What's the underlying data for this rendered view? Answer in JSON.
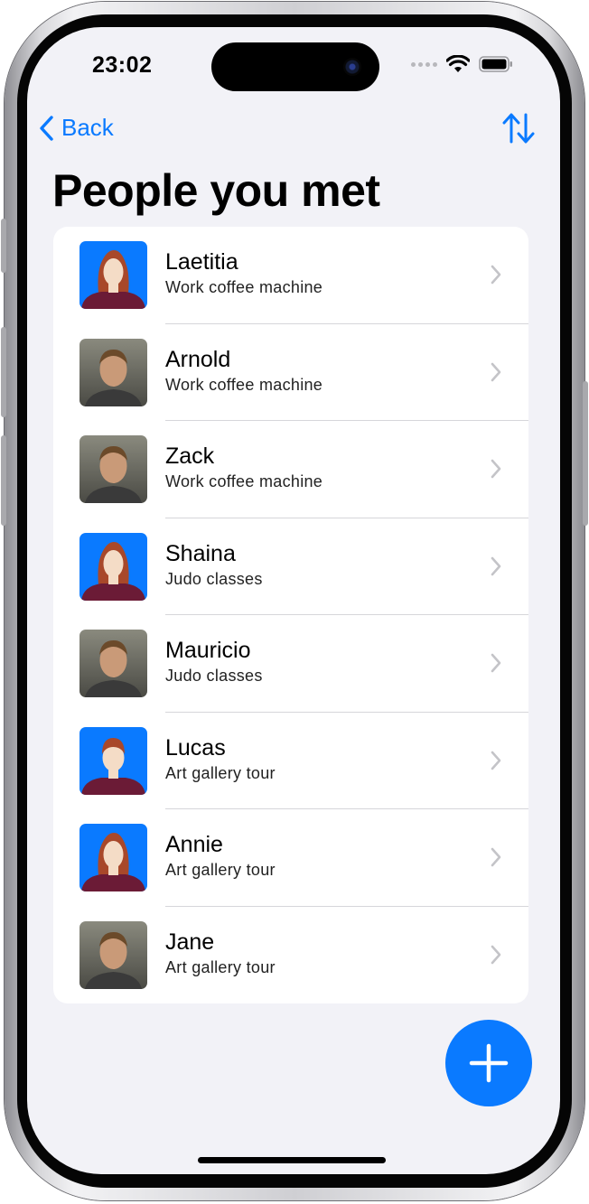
{
  "status_bar": {
    "time": "23:02"
  },
  "nav": {
    "back_label": "Back"
  },
  "page": {
    "title": "People you met"
  },
  "people": [
    {
      "name": "Laetitia",
      "place": "Work coffee machine",
      "avatar": "placeholder-woman-avatar"
    },
    {
      "name": "Arnold",
      "place": "Work coffee machine",
      "avatar": "photo-avatar"
    },
    {
      "name": "Zack",
      "place": "Work coffee machine",
      "avatar": "photo-avatar"
    },
    {
      "name": "Shaina",
      "place": "Judo classes",
      "avatar": "placeholder-woman-avatar"
    },
    {
      "name": "Mauricio",
      "place": "Judo classes",
      "avatar": "photo-avatar"
    },
    {
      "name": "Lucas",
      "place": "Art gallery tour",
      "avatar": "placeholder-man-avatar"
    },
    {
      "name": "Annie",
      "place": "Art gallery tour",
      "avatar": "placeholder-woman-avatar"
    },
    {
      "name": "Jane",
      "place": "Art gallery tour",
      "avatar": "photo-avatar"
    }
  ],
  "colors": {
    "accent": "#0a7aff",
    "background": "#f2f2f7",
    "avatar_bg": "#0a7aff",
    "shirt": "#6b1b36"
  }
}
